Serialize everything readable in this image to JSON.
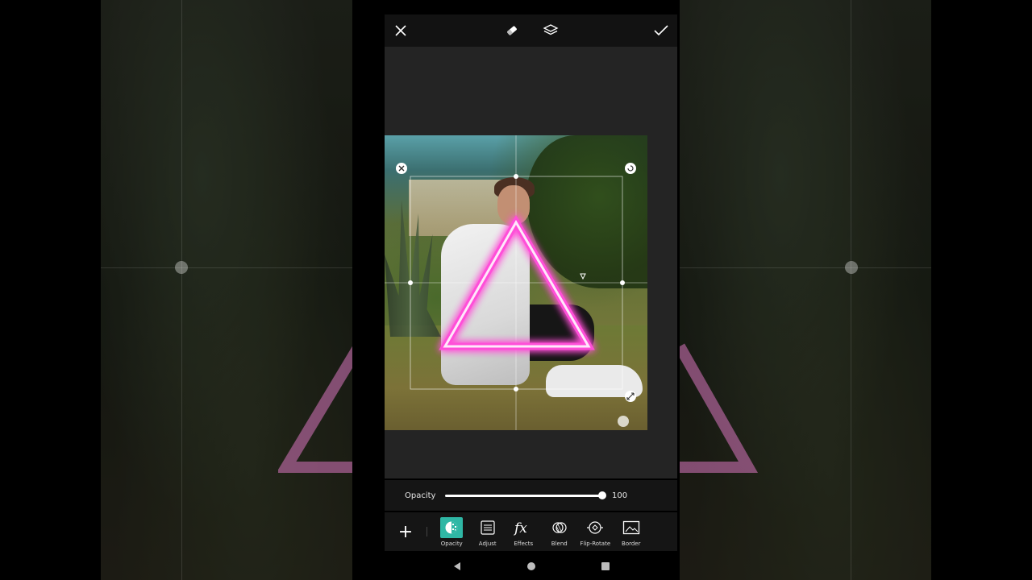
{
  "topbar": {
    "close_icon": "close-icon",
    "eraser_icon": "eraser-icon",
    "layers_icon": "layers-icon",
    "confirm_icon": "checkmark-icon"
  },
  "colors": {
    "accent": "#2fb7a5",
    "neon_pink": "#ff4fd8",
    "panel": "#151515",
    "canvas_bg": "#242424"
  },
  "opacity": {
    "label": "Opacity",
    "value": "100",
    "level_percent": 100
  },
  "toolbar": {
    "add_label": "+",
    "tools": [
      {
        "label": "Opacity",
        "icon": "opacity-icon",
        "active": true
      },
      {
        "label": "Adjust",
        "icon": "adjust-icon",
        "active": false
      },
      {
        "label": "Effects",
        "icon": "fx-icon",
        "active": false
      },
      {
        "label": "Blend",
        "icon": "blend-icon",
        "active": false
      },
      {
        "label": "Flip-Rotate",
        "icon": "flip-rotate-icon",
        "active": false
      },
      {
        "label": "Border",
        "icon": "border-icon",
        "active": false
      }
    ]
  },
  "nav": {
    "back_icon": "back-triangle-icon",
    "home_icon": "home-circle-icon",
    "recents_icon": "recents-square-icon"
  }
}
